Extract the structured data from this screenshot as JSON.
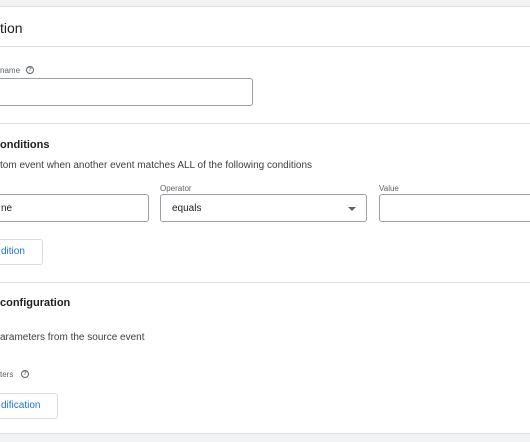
{
  "header": {
    "title": "tion"
  },
  "name_field": {
    "label": "name",
    "value": ""
  },
  "conditions": {
    "title": "onditions",
    "description": "tom event when another event matches ALL of the following conditions",
    "parameter": {
      "value": "ne"
    },
    "operator": {
      "label": "Operator",
      "value": "equals"
    },
    "value_field": {
      "label": "Value",
      "value": ""
    },
    "add_button": "dition"
  },
  "configuration": {
    "title": "configuration",
    "description": "arameters from the source event",
    "params_label": "ters",
    "add_button": "dification"
  },
  "icons": {
    "help": "help-circle-icon",
    "dropdown": "caret-down-icon"
  },
  "colors": {
    "accent": "#1a73e8",
    "border": "#dadce0"
  }
}
